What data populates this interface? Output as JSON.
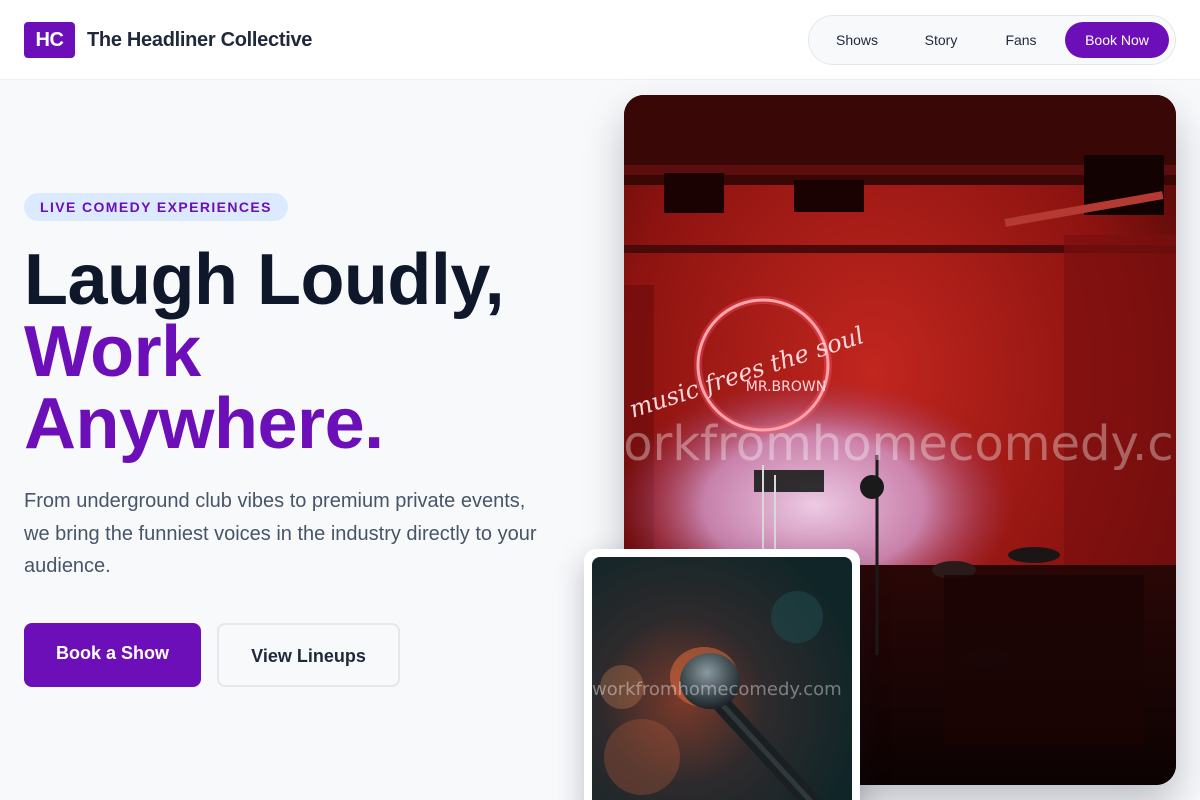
{
  "header": {
    "logo_initials": "HC",
    "brand_name": "The Headliner Collective",
    "nav": [
      {
        "label": "Shows"
      },
      {
        "label": "Story"
      },
      {
        "label": "Fans"
      }
    ],
    "cta_label": "Book Now"
  },
  "hero": {
    "badge": "LIVE COMEDY EXPERIENCES",
    "headline_line1": "Laugh Loudly,",
    "headline_line2": "Work",
    "headline_line3": "Anywhere.",
    "description": "From underground club vibes to premium private events, we bring the funniest voices in the industry directly to your audience.",
    "primary_button": "Book a Show",
    "secondary_button": "View Lineups"
  },
  "images": {
    "main_neon_line1": "music frees the soul",
    "main_neon_line2": "MR.BROWN",
    "main_watermark": "workfromhomecomedy.com",
    "card_watermark": "workfromhomecomedy.com",
    "main_alt": "comedy-club-stage-icon",
    "card_alt": "microphone-icon"
  },
  "colors": {
    "brand": "#6d0fb8",
    "heading": "#0f172a",
    "body_text": "#475569",
    "badge_bg": "#dbeafe"
  }
}
